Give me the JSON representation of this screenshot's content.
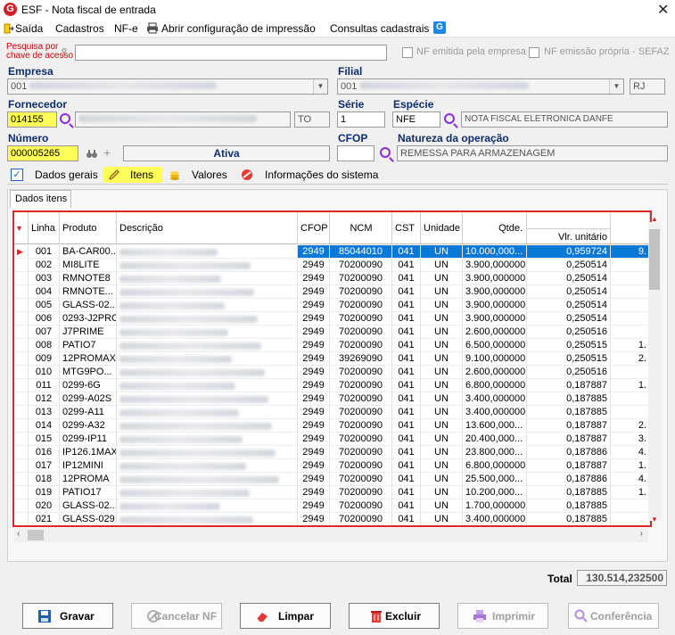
{
  "window": {
    "title": "ESF - Nota fiscal de entrada",
    "logo_letter": "G"
  },
  "menu": [
    {
      "label": "Saída"
    },
    {
      "label": "Cadastros"
    },
    {
      "label": "NF-e"
    },
    {
      "label": "Abrir configuração de impressão"
    },
    {
      "label": "Consultas cadastrais"
    }
  ],
  "search": {
    "label_line1": "Pesquisa por",
    "label_line2": "chave de acesso",
    "value": ""
  },
  "checks": {
    "nf_emitida": "NF emitida pela empresa",
    "nf_propria": "NF emissão própria - SEFAZ"
  },
  "empresa": {
    "label": "Empresa",
    "code": "001"
  },
  "filial": {
    "label": "Filial",
    "code": "001",
    "uf": "RJ"
  },
  "fornecedor": {
    "label": "Fornecedor",
    "code": "014155",
    "uf": "TO"
  },
  "serie": {
    "label": "Série",
    "value": "1"
  },
  "especie": {
    "label": "Espécie",
    "code": "NFE",
    "desc": "NOTA FISCAL ELETRONICA DANFE"
  },
  "numero": {
    "label": "Número",
    "value": "000005265",
    "status": "Ativa"
  },
  "cfop": {
    "label": "CFOP",
    "value": ""
  },
  "natureza": {
    "label": "Natureza da operação",
    "value": "REMESSA PARA ARMAZENAGEM"
  },
  "tabs": [
    {
      "label": "Dados gerais"
    },
    {
      "label": "Itens"
    },
    {
      "label": "Valores"
    },
    {
      "label": "Informações do sistema"
    }
  ],
  "subtab": "Dados itens",
  "columns": {
    "linha": "Linha",
    "produto": "Produto",
    "descricao": "Descrição",
    "cfop": "CFOP",
    "ncm": "NCM",
    "cst": "CST",
    "unidade": "Unidade",
    "qtde": "Qtde.",
    "vlr_unitario": "Vlr. unitário"
  },
  "rows": [
    {
      "linha": "001",
      "produto": "BA-CAR00...",
      "cfop": "2949",
      "ncm": "85044010",
      "cst": "041",
      "un": "UN",
      "qtde": "10.000,000...",
      "vlr": "0,959724",
      "extra": "9."
    },
    {
      "linha": "002",
      "produto": "MI8LITE",
      "cfop": "2949",
      "ncm": "70200090",
      "cst": "041",
      "un": "UN",
      "qtde": "3.900,000000",
      "vlr": "0,250514",
      "extra": ""
    },
    {
      "linha": "003",
      "produto": "RMNOTE8",
      "cfop": "2949",
      "ncm": "70200090",
      "cst": "041",
      "un": "UN",
      "qtde": "3.900,000000",
      "vlr": "0,250514",
      "extra": ""
    },
    {
      "linha": "004",
      "produto": "RMNOTE...",
      "cfop": "2949",
      "ncm": "70200090",
      "cst": "041",
      "un": "UN",
      "qtde": "3.900,000000",
      "vlr": "0,250514",
      "extra": ""
    },
    {
      "linha": "005",
      "produto": "GLASS-02...",
      "cfop": "2949",
      "ncm": "70200090",
      "cst": "041",
      "un": "UN",
      "qtde": "3.900,000000",
      "vlr": "0,250514",
      "extra": ""
    },
    {
      "linha": "006",
      "produto": "0293-J2PRO",
      "cfop": "2949",
      "ncm": "70200090",
      "cst": "041",
      "un": "UN",
      "qtde": "3.900,000000",
      "vlr": "0,250514",
      "extra": ""
    },
    {
      "linha": "007",
      "produto": "J7PRIME",
      "cfop": "2949",
      "ncm": "70200090",
      "cst": "041",
      "un": "UN",
      "qtde": "2.600,000000",
      "vlr": "0,250516",
      "extra": ""
    },
    {
      "linha": "008",
      "produto": "PATIO7",
      "cfop": "2949",
      "ncm": "70200090",
      "cst": "041",
      "un": "UN",
      "qtde": "6.500,000000",
      "vlr": "0,250515",
      "extra": "1."
    },
    {
      "linha": "009",
      "produto": "12PROMAX",
      "cfop": "2949",
      "ncm": "39269090",
      "cst": "041",
      "un": "UN",
      "qtde": "9.100,000000",
      "vlr": "0,250515",
      "extra": "2."
    },
    {
      "linha": "010",
      "produto": "MTG9PO...",
      "cfop": "2949",
      "ncm": "70200090",
      "cst": "041",
      "un": "UN",
      "qtde": "2.600,000000",
      "vlr": "0,250516",
      "extra": ""
    },
    {
      "linha": "011",
      "produto": "0299-6G",
      "cfop": "2949",
      "ncm": "70200090",
      "cst": "041",
      "un": "UN",
      "qtde": "6.800,000000",
      "vlr": "0,187887",
      "extra": "1."
    },
    {
      "linha": "012",
      "produto": "0299-A02S",
      "cfop": "2949",
      "ncm": "70200090",
      "cst": "041",
      "un": "UN",
      "qtde": "3.400,000000",
      "vlr": "0,187885",
      "extra": ""
    },
    {
      "linha": "013",
      "produto": "0299-A11",
      "cfop": "2949",
      "ncm": "70200090",
      "cst": "041",
      "un": "UN",
      "qtde": "3.400,000000",
      "vlr": "0,187885",
      "extra": ""
    },
    {
      "linha": "014",
      "produto": "0299-A32",
      "cfop": "2949",
      "ncm": "70200090",
      "cst": "041",
      "un": "UN",
      "qtde": "13.600,000...",
      "vlr": "0,187887",
      "extra": "2."
    },
    {
      "linha": "015",
      "produto": "0299-IP11",
      "cfop": "2949",
      "ncm": "70200090",
      "cst": "041",
      "un": "UN",
      "qtde": "20.400,000...",
      "vlr": "0,187887",
      "extra": "3."
    },
    {
      "linha": "016",
      "produto": "IP126.1MAX",
      "cfop": "2949",
      "ncm": "70200090",
      "cst": "041",
      "un": "UN",
      "qtde": "23.800,000...",
      "vlr": "0,187886",
      "extra": "4."
    },
    {
      "linha": "017",
      "produto": "IP12MINI",
      "cfop": "2949",
      "ncm": "70200090",
      "cst": "041",
      "un": "UN",
      "qtde": "6.800,000000",
      "vlr": "0,187887",
      "extra": "1."
    },
    {
      "linha": "018",
      "produto": "12PROMA",
      "cfop": "2949",
      "ncm": "70200090",
      "cst": "041",
      "un": "UN",
      "qtde": "25.500,000...",
      "vlr": "0,187886",
      "extra": "4."
    },
    {
      "linha": "019",
      "produto": "PATIO17",
      "cfop": "2949",
      "ncm": "70200090",
      "cst": "041",
      "un": "UN",
      "qtde": "10.200,000...",
      "vlr": "0,187885",
      "extra": "1."
    },
    {
      "linha": "020",
      "produto": "GLASS-02...",
      "cfop": "2949",
      "ncm": "70200090",
      "cst": "041",
      "un": "UN",
      "qtde": "1.700,000000",
      "vlr": "0,187885",
      "extra": ""
    },
    {
      "linha": "021",
      "produto": "GLASS-029",
      "cfop": "2949",
      "ncm": "70200090",
      "cst": "041",
      "un": "UN",
      "qtde": "3.400,000000",
      "vlr": "0,187885",
      "extra": ""
    }
  ],
  "total": {
    "label": "Total",
    "value": "130.514,232500"
  },
  "buttons": {
    "gravar": "Gravar",
    "cancelar": "Cancelar NF",
    "limpar": "Limpar",
    "excluir": "Excluir",
    "imprimir": "Imprimir",
    "conferencia": "Conferência"
  },
  "colors": {
    "highlight_yellow": "#ffff5a",
    "label_blue": "#0d2d6c",
    "selection_blue": "#0a78d7",
    "grid_border_red": "#e12424",
    "logo_red": "#d21f26"
  }
}
